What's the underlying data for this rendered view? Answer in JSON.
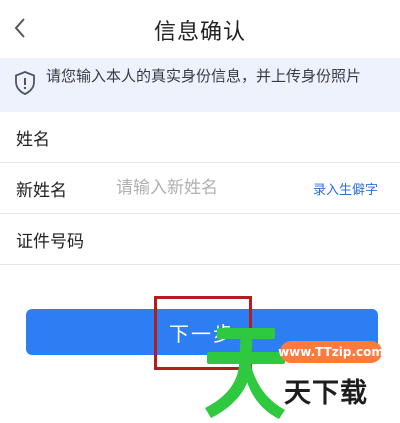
{
  "header": {
    "title": "信息确认",
    "back_icon": "chevron-left-icon"
  },
  "notice": {
    "icon": "shield-icon",
    "text": "请您输入本人的真实身份信息，并上传身份照片"
  },
  "form": {
    "name_label": "姓名",
    "new_name_label": "新姓名",
    "new_name_placeholder": "请输入新姓名",
    "rare_char_link": "录入生僻字",
    "id_number_label": "证件号码"
  },
  "actions": {
    "next_label": "下一步"
  },
  "watermark": {
    "url": "www.TTzip.com",
    "text": "天下载"
  },
  "colors": {
    "primary": "#2d7ef3",
    "link": "#2d6fd8",
    "notice_bg": "#eef2fc",
    "highlight": "#b21e1e",
    "watermark_green": "#2fc93f",
    "watermark_orange": "#ff7a3d"
  }
}
